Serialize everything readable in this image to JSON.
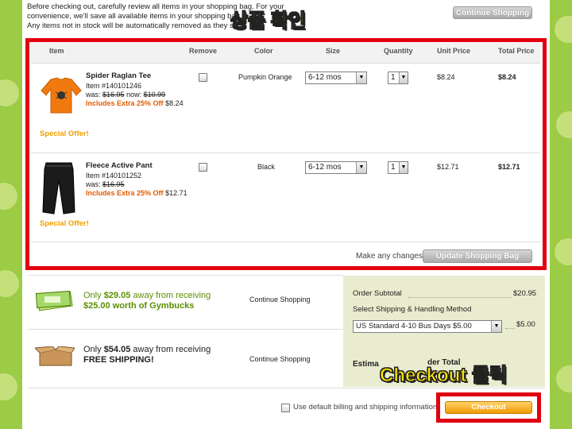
{
  "intro": {
    "line1": "Before checking out, carefully review all items in your shopping bag. For your",
    "line2": "convenience, we'll save all available items in your shopping bag",
    "line3": "Any items not in stock will be automatically removed as they s"
  },
  "overlays": {
    "top_title": "상품 확인",
    "checkout_title": "Checkout 클릭"
  },
  "buttons": {
    "continue_shopping_top": "Continue Shopping",
    "update_bag": "Update Shopping Bag",
    "checkout": "Checkout"
  },
  "table": {
    "headers": {
      "item": "Item",
      "remove": "Remove",
      "color": "Color",
      "size": "Size",
      "quantity": "Quantity",
      "unit_price": "Unit Price",
      "total_price": "Total Price"
    },
    "rows": [
      {
        "name": "Spider Raglan Tee",
        "item_no": "Item #140101246",
        "was_label": "was:",
        "was_price": "$16.95",
        "now_label": "now:",
        "now_price": "$10.99",
        "extra": "Includes Extra 25% Off",
        "extra_price": "$8.24",
        "special": "Special Offer!",
        "color": "Pumpkin Orange",
        "size": "6-12 mos",
        "quantity": "1",
        "unit_price": "$8.24",
        "total_price": "$8.24"
      },
      {
        "name": "Fleece Active Pant",
        "item_no": "Item #140101252",
        "was_label": "was:",
        "was_price": "$16.95",
        "now_label": "",
        "now_price": "",
        "extra": "Includes Extra 25% Off",
        "extra_price": "$12.71",
        "special": "Special Offer!",
        "color": "Black",
        "size": "6-12 mos",
        "quantity": "1",
        "unit_price": "$12.71",
        "total_price": "$12.71"
      }
    ],
    "changes_label": "Make any changes?"
  },
  "promos": [
    {
      "line1_prefix": "Only",
      "line1_amount": "$29.05",
      "line1_suffix": "away from receiving",
      "line2": "$25.00 worth of Gymbucks",
      "link": "Continue Shopping",
      "icon": "gymbucks-icon"
    },
    {
      "line1_prefix": "Only",
      "line1_amount": "$54.05",
      "line1_suffix": "away from receiving",
      "line2": "FREE SHIPPING!",
      "link": "Continue Shopping",
      "icon": "box-icon"
    }
  ],
  "summary": {
    "subtotal_label": "Order Subtotal",
    "subtotal_value": "$20.95",
    "shipping_label": "Select Shipping & Handling Method",
    "shipping_option": "US Standard 4-10 Bus Days $5.00",
    "shipping_value": "$5.00",
    "estimated_label_a": "Estima",
    "estimated_label_b": "der Total"
  },
  "footer": {
    "default_billing_label": "Use default billing and shipping information"
  },
  "colors": {
    "accent_green": "#8ab83a",
    "highlight_red": "#e00010",
    "checkout_orange": "#f09a00",
    "overlay_yellow": "#ffe800"
  }
}
